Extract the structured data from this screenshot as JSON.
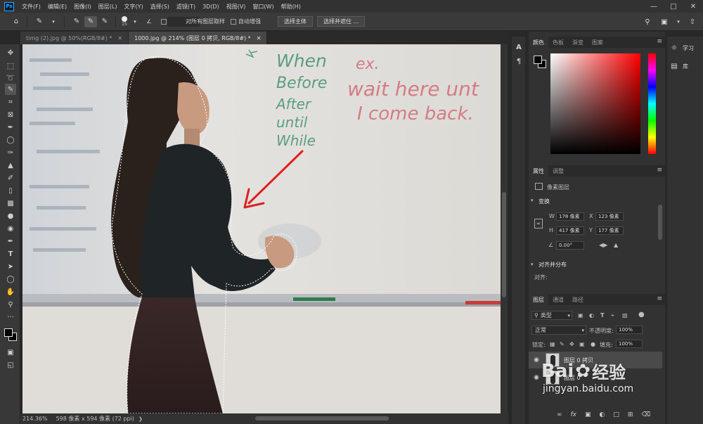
{
  "app": {
    "logo": "Ps"
  },
  "menu": {
    "items": [
      "文件(F)",
      "编辑(E)",
      "图像(I)",
      "图层(L)",
      "文字(Y)",
      "选择(S)",
      "滤镜(T)",
      "3D(D)",
      "视图(V)",
      "窗口(W)",
      "帮助(H)"
    ]
  },
  "options": {
    "brush_size": "15",
    "sample_all_layers": "对所有图层取样",
    "auto_enhance": "自动增强",
    "select_subject": "选择主体",
    "select_and_mask": "选择并遮住 ..."
  },
  "tabs": [
    {
      "label": "timg (2).jpg @ 50%(RGB/8#) *",
      "active": false
    },
    {
      "label": "1000.jpg @ 214% (图层 0 拷贝, RGB/8#) *",
      "active": true
    }
  ],
  "canvas": {
    "whiteboard_words_left": [
      "When",
      "Before",
      "After",
      "until",
      "While"
    ],
    "whiteboard_words_right": [
      "ex.",
      "wait here unt",
      "I come back."
    ]
  },
  "status": {
    "zoom": "214.36%",
    "doc_info": "598 像素 x 594 像素 (72 ppi)"
  },
  "color_panel": {
    "tabs": [
      "颜色",
      "色板",
      "渐变",
      "图案"
    ]
  },
  "properties_panel": {
    "tabs": [
      "属性",
      "调整"
    ],
    "layer_type": "像素图层",
    "transform_title": "变换",
    "w_label": "W",
    "w_value": "178 像素",
    "x_label": "X",
    "x_value": "123 像素",
    "h_label": "H",
    "h_value": "417 像素",
    "y_label": "Y",
    "y_value": "177 像素",
    "angle_value": "0.00°",
    "align_title": "对齐并分布",
    "align_label": "对齐:"
  },
  "layers_panel": {
    "tabs": [
      "图层",
      "通道",
      "路径"
    ],
    "filter_kind": "类型",
    "blend_mode": "正常",
    "opacity_label": "不透明度:",
    "opacity_value": "100%",
    "lock_label": "锁定:",
    "fill_label": "填充:",
    "fill_value": "100%",
    "layers": [
      {
        "name": "图层 0 拷贝",
        "visible": true
      },
      {
        "name": "图层 0",
        "visible": true
      }
    ]
  },
  "learn_panel": {
    "items": [
      "学习",
      "库"
    ]
  },
  "watermark": {
    "brand": "Bai",
    "brand_tail": "经验",
    "url": "jingyan.baidu.com"
  },
  "colors": {
    "ps_blue": "#31a8ff",
    "arrow_red": "#e02020",
    "marker_green": "#5a9e7e",
    "marker_red": "#d47c86"
  }
}
